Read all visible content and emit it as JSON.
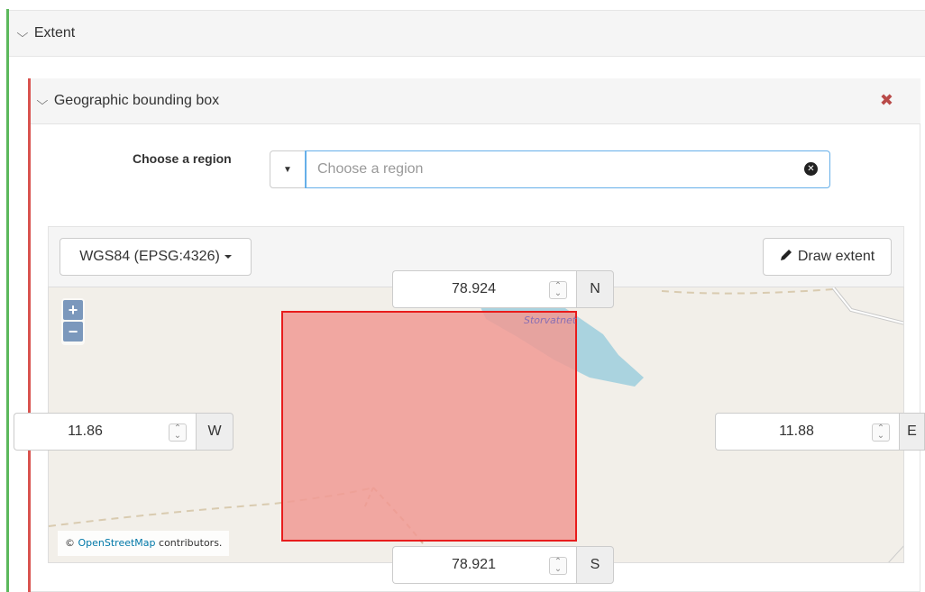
{
  "extent": {
    "title": "Extent",
    "chevron": "chevron-down-icon"
  },
  "bbox": {
    "title": "Geographic bounding box",
    "remove_icon": "close-icon",
    "remove_symbol": "✖",
    "region_label": "Choose a region",
    "region_placeholder": "Choose a region",
    "region_value": "",
    "crs_label": "WGS84 (EPSG:4326)",
    "draw_label": "Draw extent",
    "north": {
      "value": "78.924",
      "dir": "N"
    },
    "south": {
      "value": "78.921",
      "dir": "S"
    },
    "west": {
      "value": "11.86",
      "dir": "W"
    },
    "east": {
      "value": "11.88",
      "dir": "E"
    }
  },
  "map": {
    "zoom_in": "+",
    "zoom_out": "−",
    "attribution_prefix": "©",
    "attribution_link": "OpenStreetMap",
    "attribution_suffix": "contributors.",
    "place_name": "Storvatnet",
    "bbox_fill": "#f19a94",
    "bbox_stroke": "#e81c1c",
    "water_color": "#aad3df"
  },
  "colors": {
    "success": "#5cb85c",
    "danger": "#d9534f",
    "focus": "#66afe9"
  }
}
